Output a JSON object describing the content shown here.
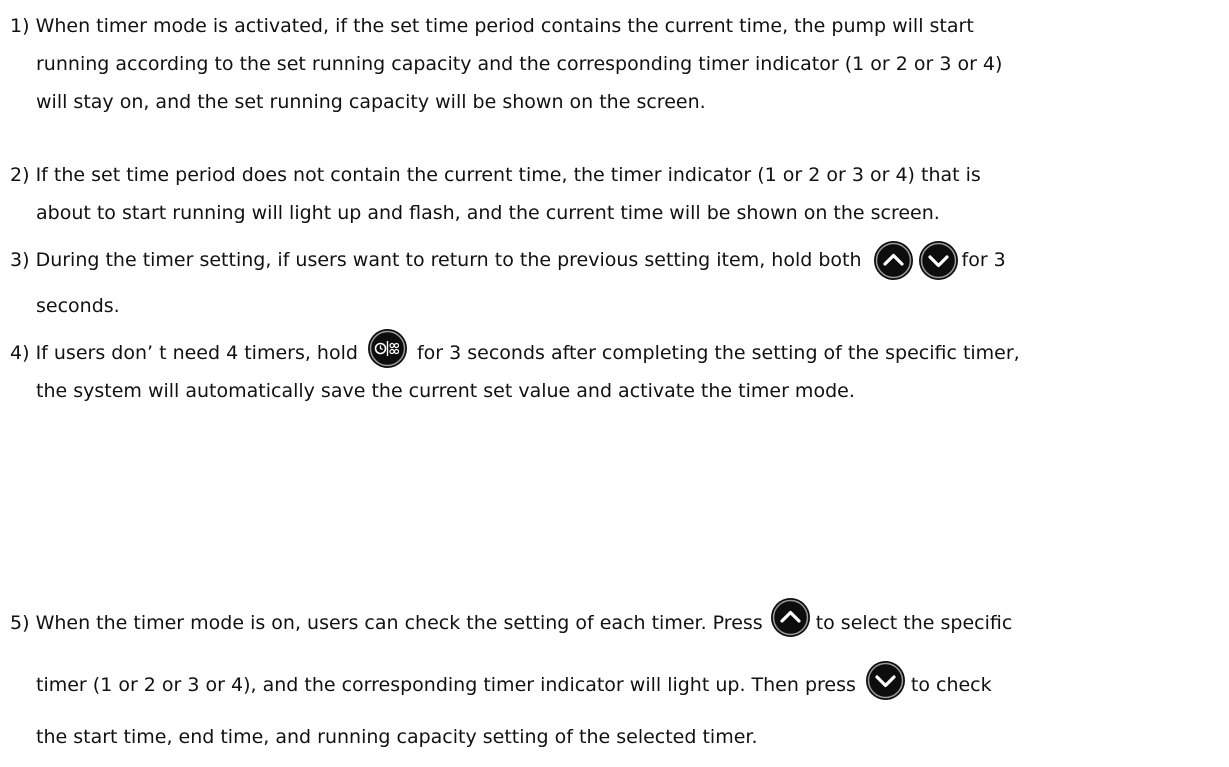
{
  "items": [
    {
      "number": "1)",
      "lines": [
        "When timer mode is activated, if the set time period contains the current time, the pump will start",
        "running according to the set running capacity and the corresponding timer indicator (1 or 2 or 3 or 4)",
        "will stay on, and the set running capacity will be shown on the screen."
      ]
    },
    {
      "number": "2)",
      "lines": [
        "If the set time period does not contain the current time, the timer indicator (1 or 2 or 3 or 4) that is",
        "about to start running will light up and flash, and the current time will be shown on the screen."
      ]
    },
    {
      "number": "3)",
      "line1_before": "During the timer setting, if users want to return to the previous setting item, hold both",
      "line1_after": "for 3",
      "line2": "seconds."
    },
    {
      "number": "4)",
      "line1_before": "If users don’ t need 4 timers, hold",
      "line1_after": "for 3 seconds after completing the setting of the specific timer,",
      "line2": "the system will automatically save the current set value and activate the timer mode."
    },
    {
      "number": "5)",
      "line1_before": "When the timer mode is on, users can check the setting of each timer. Press",
      "line1_after": "to select the specific",
      "line2_before": "timer (1 or 2 or 3 or 4), and the corresponding timer indicator will light up. Then press",
      "line2_after": "to check",
      "line3": "the start time, end time, and running capacity setting of the selected timer."
    }
  ],
  "icons": {
    "up": "up-arrow-button-icon",
    "down": "down-arrow-button-icon",
    "timer_mode": "timer-mode-button-icon",
    "icon_bg_color": "#0d0d0d",
    "icon_ring_color": "#9a9a9a",
    "icon_fg_color": "#ffffff"
  }
}
